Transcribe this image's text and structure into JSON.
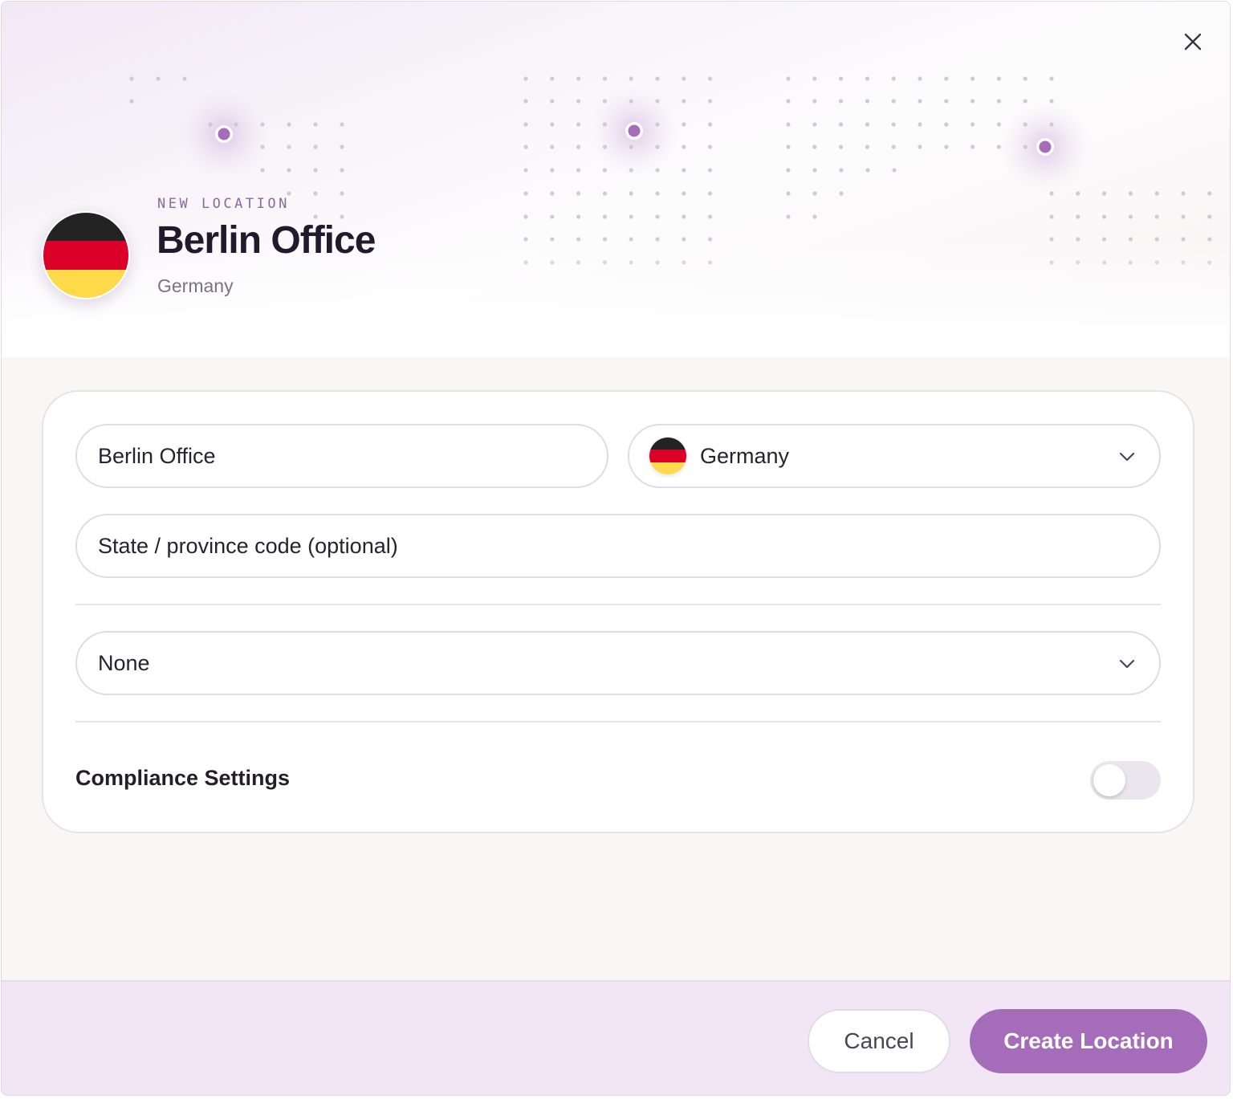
{
  "header": {
    "eyebrow": "NEW LOCATION",
    "title": "Berlin Office",
    "subtitle": "Germany",
    "flag_icon": "germany-flag-icon",
    "close_icon": "close-icon"
  },
  "form": {
    "name_value": "Berlin Office",
    "country_value": "Germany",
    "state_placeholder": "State / province code (optional)",
    "select_value": "None",
    "compliance_label": "Compliance Settings",
    "compliance_enabled": false
  },
  "footer": {
    "cancel_label": "Cancel",
    "create_label": "Create Location"
  },
  "colors": {
    "accent": "#a46cb9",
    "flag_black": "#232323",
    "flag_red": "#dc0028",
    "flag_gold": "#fed94a"
  }
}
